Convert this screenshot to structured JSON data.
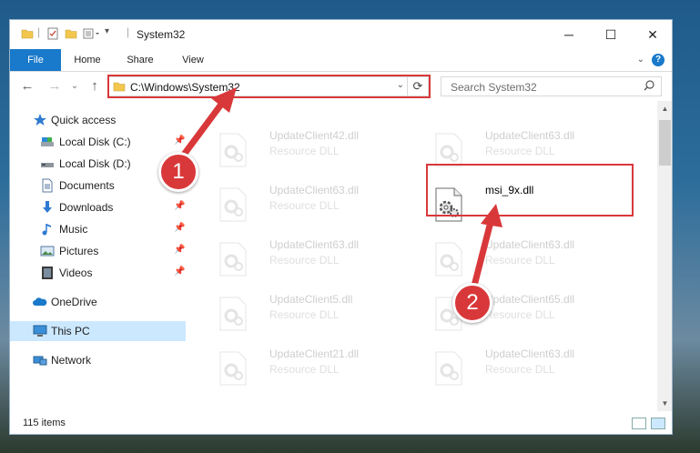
{
  "window": {
    "title": "System32",
    "buttons": {
      "minimize": "─",
      "maximize": "☐",
      "close": "✕"
    }
  },
  "ribbon": {
    "tabs": [
      "File",
      "Home",
      "Share",
      "View"
    ],
    "help": "?"
  },
  "nav": {
    "back": "←",
    "forward": "→",
    "recent": "⌄",
    "up": "↑",
    "address": "C:\\Windows\\System32",
    "address_dropdown": "⌄",
    "refresh": "⟳",
    "search_placeholder": "Search System32"
  },
  "sidebar": {
    "items": [
      {
        "label": "Quick access",
        "icon": "star-icon"
      },
      {
        "label": "Local Disk (C:)",
        "icon": "drive-icon",
        "pinned": true
      },
      {
        "label": "Local Disk (D:)",
        "icon": "drive-icon"
      },
      {
        "label": "Documents",
        "icon": "documents-icon",
        "pinned": true
      },
      {
        "label": "Downloads",
        "icon": "download-icon",
        "pinned": true
      },
      {
        "label": "Music",
        "icon": "music-icon",
        "pinned": true
      },
      {
        "label": "Pictures",
        "icon": "pictures-icon",
        "pinned": true
      },
      {
        "label": "Videos",
        "icon": "videos-icon",
        "pinned": true
      },
      {
        "label": "OneDrive",
        "icon": "cloud-icon"
      },
      {
        "label": "This PC",
        "icon": "computer-icon",
        "selected": true
      },
      {
        "label": "Network",
        "icon": "network-icon"
      }
    ],
    "pin_glyph": "📌"
  },
  "files": [
    {
      "name": "UpdateClient42.dll",
      "type": "Resource DLL"
    },
    {
      "name": "UpdateClient63.dll",
      "type": "Resource DLL"
    },
    {
      "name": "UpdateClient63.dll",
      "type": "Resource DLL"
    },
    {
      "name": "msi_9x.dll",
      "type": ""
    },
    {
      "name": "UpdateClient63.dll",
      "type": "Resource DLL"
    },
    {
      "name": "UpdateClient63.dll",
      "type": "Resource DLL"
    },
    {
      "name": "UpdateClient5.dll",
      "type": "Resource DLL"
    },
    {
      "name": "UpdateClient65.dll",
      "type": "Resource DLL"
    },
    {
      "name": "UpdateClient21.dll",
      "type": "Resource DLL"
    },
    {
      "name": "UpdateClient63.dll",
      "type": "Resource DLL"
    }
  ],
  "status": {
    "count": "115 items"
  },
  "annotations": {
    "step1": "1",
    "step2": "2",
    "color": "#d9383a"
  },
  "colors": {
    "accent": "#1979ca",
    "selected": "#cce8ff"
  }
}
